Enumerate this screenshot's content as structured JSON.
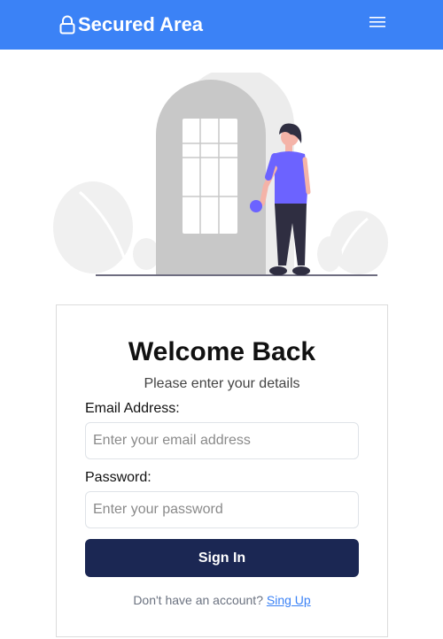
{
  "navbar": {
    "brand_label": "Secured Area",
    "brand_icon": "lock-icon",
    "menu_icon": "hamburger-menu-icon",
    "bg_color": "#3b82f6"
  },
  "illustration": {
    "icon": "person-at-door-illustration"
  },
  "card": {
    "title": "Welcome Back",
    "subtitle": "Please enter your details",
    "email_label": "Email Address:",
    "email_placeholder": "Enter your email address",
    "email_value": "",
    "password_label": "Password:",
    "password_placeholder": "Enter your password",
    "password_value": "",
    "submit_label": "Sign In",
    "submit_color": "#1b2753",
    "footer_text": "Don't have an account?",
    "footer_link": "Sing Up"
  }
}
